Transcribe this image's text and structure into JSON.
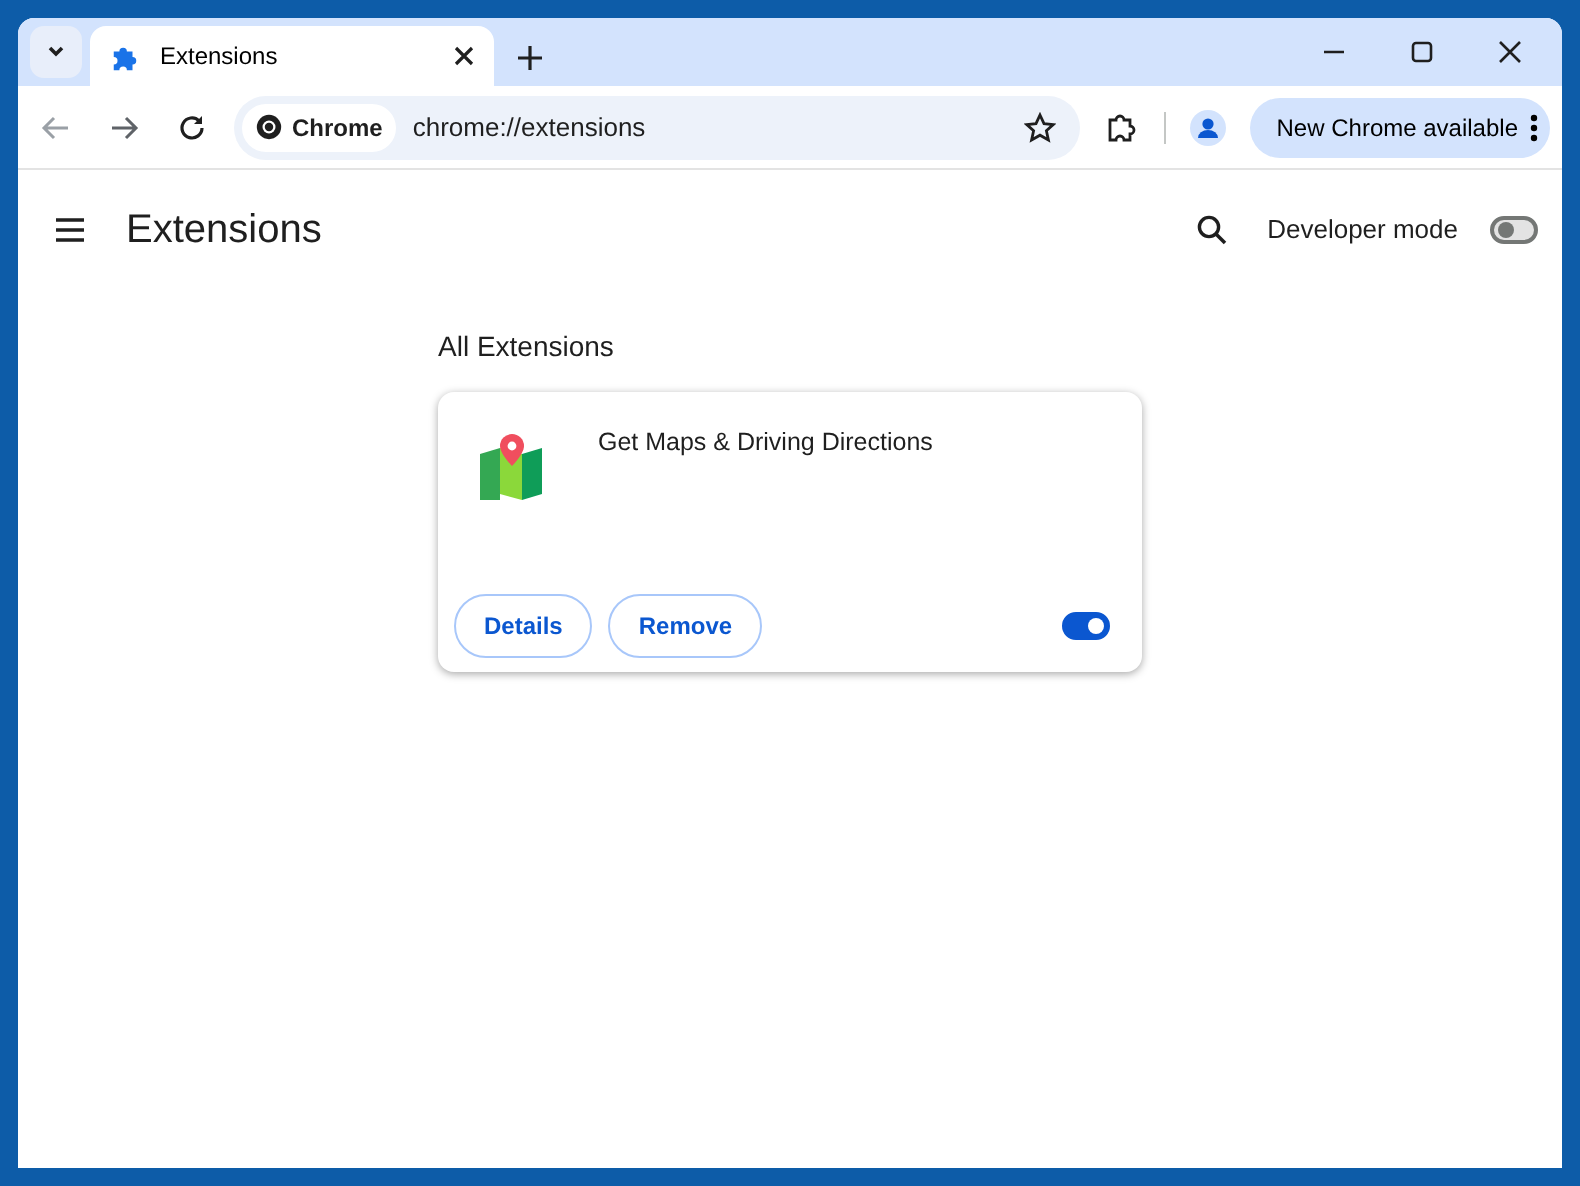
{
  "tabs": [
    {
      "title": "Extensions",
      "selected": true
    }
  ],
  "toolbar": {
    "address_chip": "Chrome",
    "url": "chrome://extensions",
    "update_button": "New Chrome available"
  },
  "page": {
    "title": "Extensions",
    "developer_mode": {
      "label": "Developer mode",
      "on": false
    },
    "section_title": "All Extensions",
    "extensions": [
      {
        "name": "Get Maps & Driving Directions",
        "buttons": [
          "Details",
          "Remove"
        ],
        "enabled": true
      }
    ]
  }
}
